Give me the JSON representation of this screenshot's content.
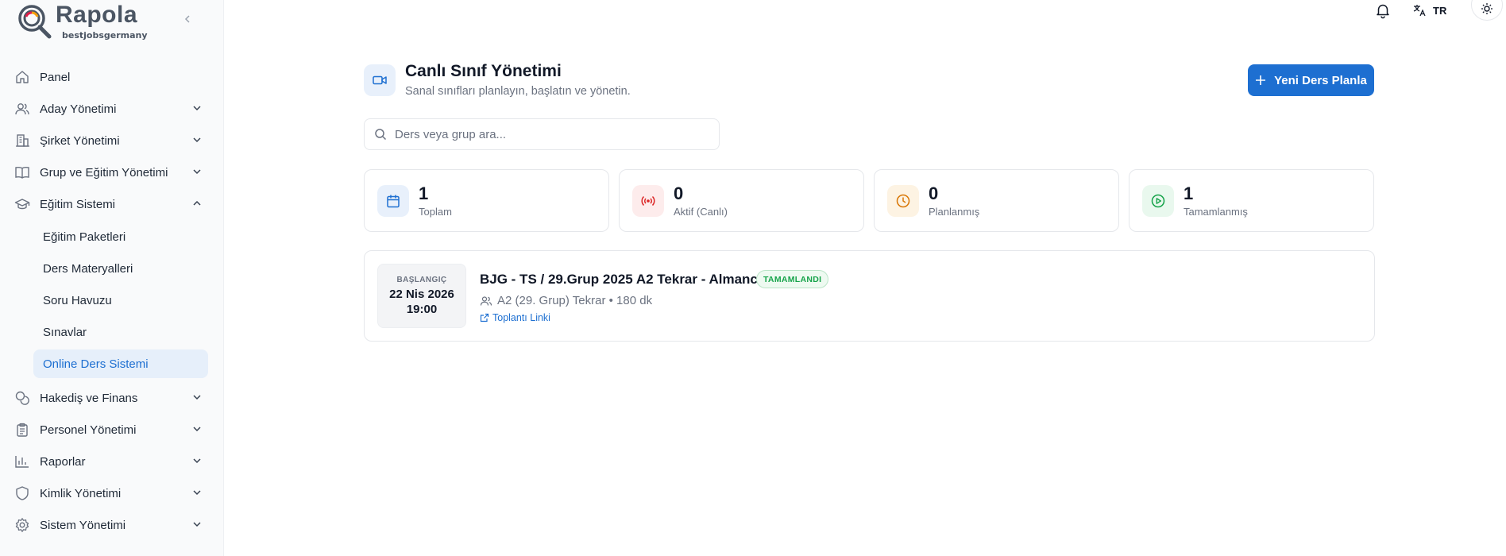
{
  "brand": {
    "name": "Rapola",
    "sub": "bestjobsgermany"
  },
  "topbar": {
    "lang": "TR"
  },
  "sidebar": {
    "items": [
      {
        "label": "Panel",
        "icon": "home-icon"
      },
      {
        "label": "Aday Yönetimi",
        "icon": "users-icon"
      },
      {
        "label": "Şirket Yönetimi",
        "icon": "building-icon"
      },
      {
        "label": "Grup ve Eğitim Yönetimi",
        "icon": "book-icon"
      },
      {
        "label": "Eğitim Sistemi",
        "icon": "graduation-cap-icon",
        "expanded": true
      },
      {
        "label": "Hakediş ve Finans",
        "icon": "coins-icon"
      },
      {
        "label": "Personel Yönetimi",
        "icon": "clipboard-icon"
      },
      {
        "label": "Raporlar",
        "icon": "bar-chart-icon"
      },
      {
        "label": "Kimlik Yönetimi",
        "icon": "shield-icon"
      },
      {
        "label": "Sistem Yönetimi",
        "icon": "gear-icon"
      }
    ],
    "subitems": [
      {
        "label": "Eğitim Paketleri"
      },
      {
        "label": "Ders Materyalleri"
      },
      {
        "label": "Soru Havuzu"
      },
      {
        "label": "Sınavlar"
      },
      {
        "label": "Online Ders Sistemi",
        "active": true
      }
    ]
  },
  "header": {
    "title": "Canlı Sınıf Yönetimi",
    "subtitle": "Sanal sınıfları planlayın, başlatın ve yönetin.",
    "new_button": "Yeni Ders Planla"
  },
  "search": {
    "placeholder": "Ders veya grup ara..."
  },
  "stats": [
    {
      "value": "1",
      "label": "Toplam",
      "icon": "calendar-icon",
      "color": "#1d6fd1",
      "bg": "#e8f0fb"
    },
    {
      "value": "0",
      "label": "Aktif (Canlı)",
      "icon": "broadcast-icon",
      "color": "#dc2626",
      "bg": "#fdecec"
    },
    {
      "value": "0",
      "label": "Planlanmış",
      "icon": "clock-icon",
      "color": "#d97706",
      "bg": "#fdf3e3"
    },
    {
      "value": "1",
      "label": "Tamamlanmış",
      "icon": "play-circle-icon",
      "color": "#16a34a",
      "bg": "#e9f8ee"
    }
  ],
  "lessons": [
    {
      "start_label": "BAŞLANGIÇ",
      "date": "22 Nis 2026",
      "time": "19:00",
      "title": "BJG - TS / 29.Grup 2025 A2 Tekrar - Almanca",
      "status": "TAMAMLANDI",
      "meta": "A2 (29. Grup) Tekrar • 180 dk",
      "link": "Toplantı Linki"
    }
  ],
  "colors": {
    "accent": "#1d6fd1",
    "success": "#16a34a"
  }
}
